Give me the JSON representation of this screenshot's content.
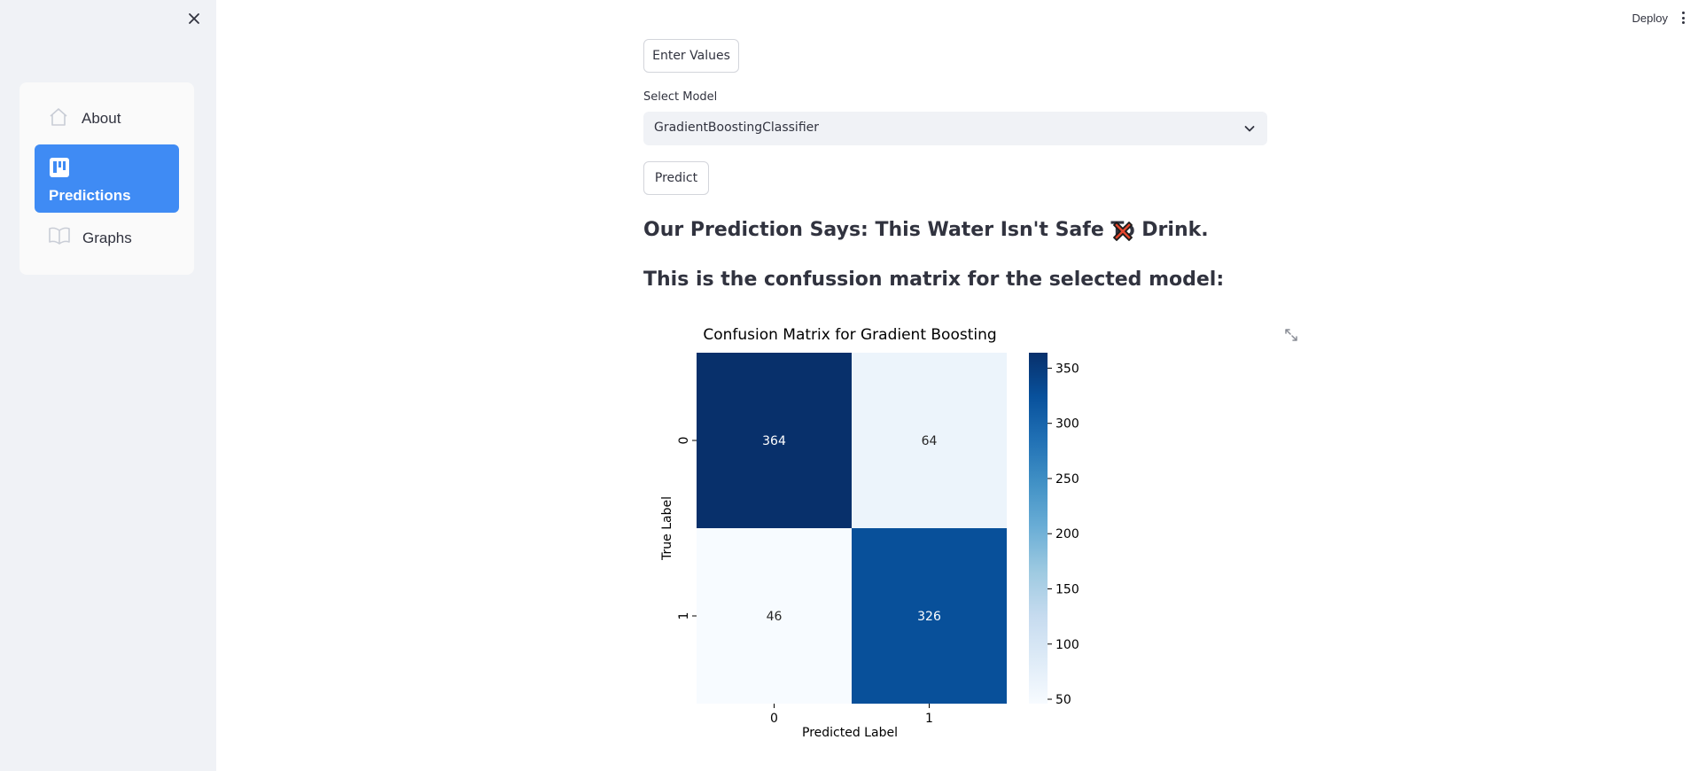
{
  "sidebar": {
    "items": [
      {
        "label": "About",
        "icon": "house-icon"
      },
      {
        "label": "Predictions",
        "icon": "kanban-icon",
        "active": true
      },
      {
        "label": "Graphs",
        "icon": "book-icon"
      }
    ],
    "active_color": "#3f8bf4"
  },
  "header": {
    "deploy_label": "Deploy"
  },
  "main": {
    "enter_values_label": "Enter Values",
    "select_model_label": "Select Model",
    "selected_model": "GradientBoostingClassifier",
    "predict_label": "Predict",
    "prediction_text": "Our Prediction Says: This Water Isn't Safe To Drink.",
    "matrix_heading": "This is the confussion matrix for the selected model:"
  },
  "chart_data": {
    "type": "heatmap",
    "title": "Confusion Matrix for Gradient Boosting",
    "xlabel": "Predicted Label",
    "ylabel": "True Label",
    "x_categories": [
      "0",
      "1"
    ],
    "y_categories": [
      "0",
      "1"
    ],
    "values": [
      [
        364,
        64
      ],
      [
        46,
        326
      ]
    ],
    "colormap": "Blues",
    "colorbar_ticks": [
      350,
      300,
      250,
      200,
      150,
      100,
      50
    ],
    "colorbar_range": [
      46,
      364
    ]
  }
}
